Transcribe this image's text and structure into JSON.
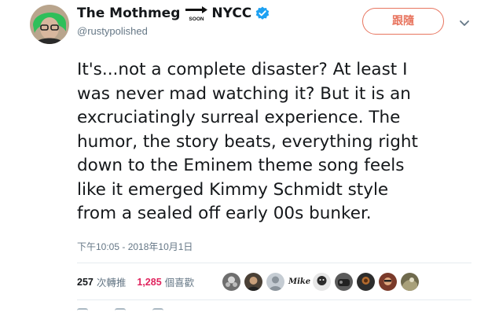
{
  "author": {
    "name_part1": "The Mothmeg",
    "soon_label": "SOON",
    "name_part2": "NYCC",
    "handle": "@rustypolished",
    "verified": true
  },
  "follow_button": {
    "label": "跟隨"
  },
  "tweet": {
    "lines": [
      "It's...not a complete disaster? At least I",
      "was never mad watching it? But it is an",
      "excruciatingly surreal experience. The",
      "humor, the story beats, everything right",
      "down to the Eminem theme song feels",
      "like it emerged Kimmy Schmidt style",
      "from a sealed off early 00s bunker."
    ],
    "timestamp": "下午10:05 - 2018年10月1日"
  },
  "stats": {
    "retweets_count": "257",
    "retweets_label": "次轉推",
    "likes_count": "1,285",
    "likes_label": "個喜歡"
  },
  "likers": {
    "text_avatar": "Mike"
  },
  "colors": {
    "accent": "#e8755f",
    "verified": "#1da1f2",
    "text": "#14171a",
    "muted": "#657786",
    "likes": "#e0245e"
  }
}
